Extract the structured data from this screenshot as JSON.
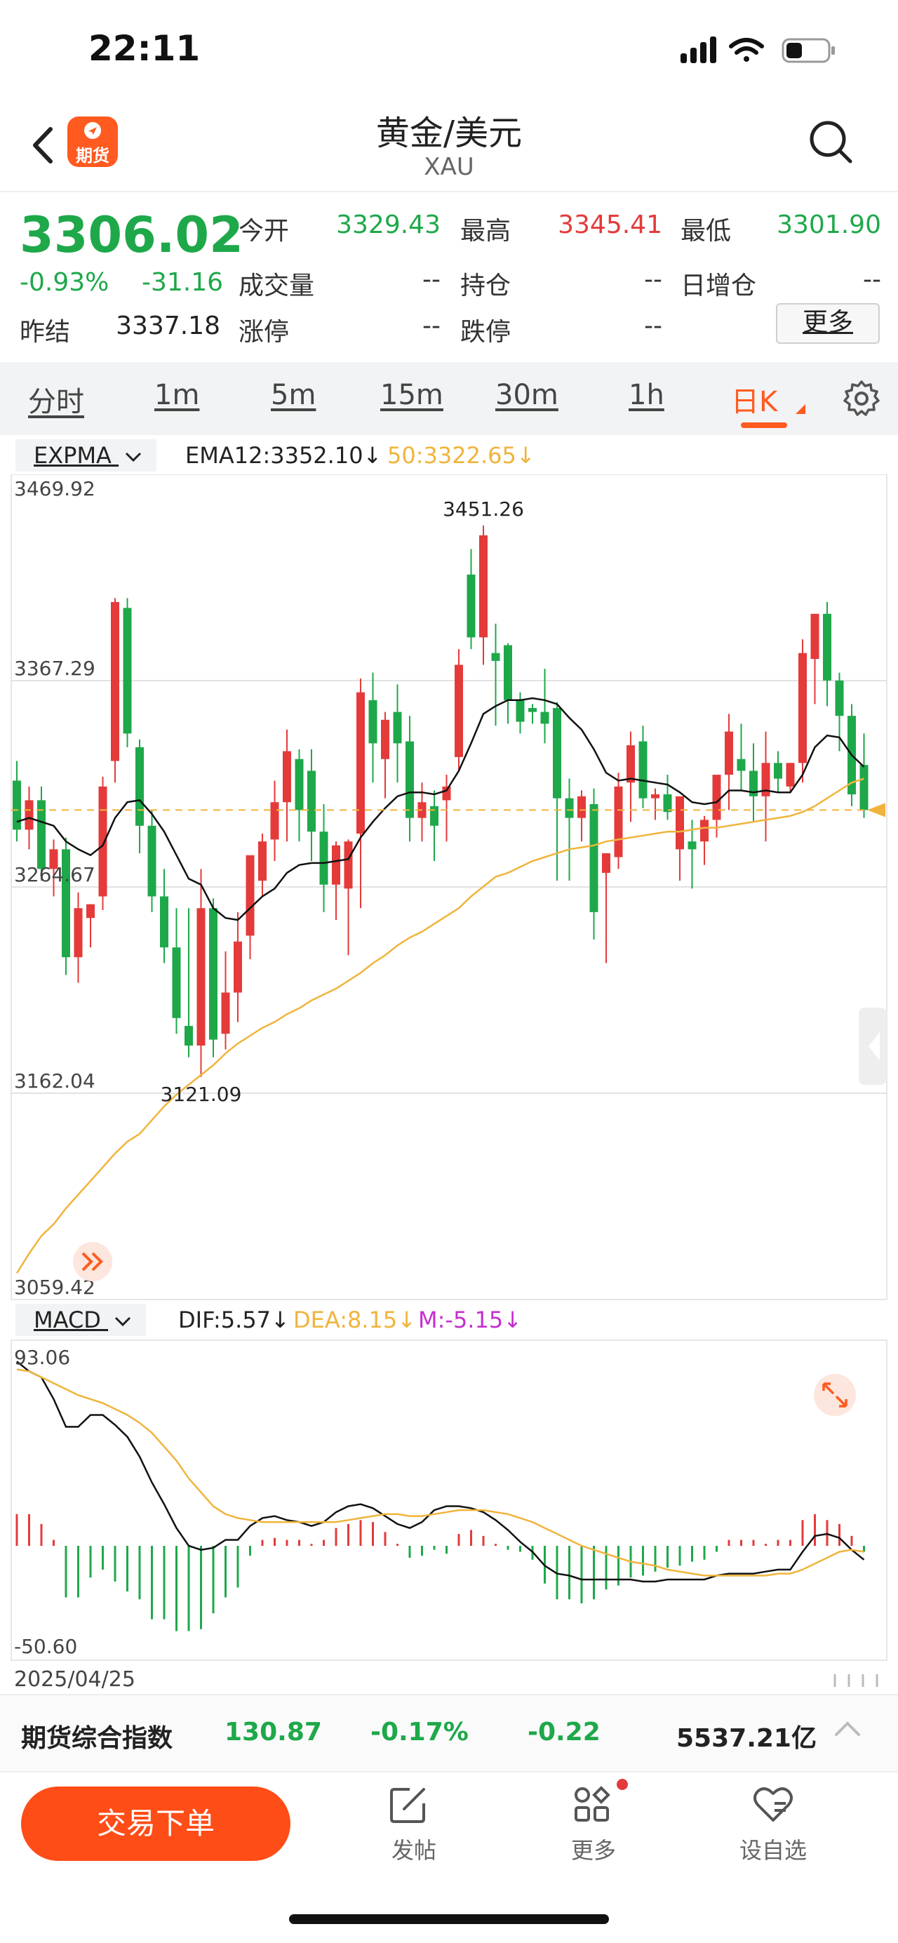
{
  "status_bar": {
    "time": "22:11"
  },
  "header": {
    "title": "黄金/美元",
    "subtitle": "XAU",
    "logo_text": "期货"
  },
  "quote": {
    "price": "3306.02",
    "change_pct": "-0.93%",
    "change_abs": "-31.16",
    "fields": [
      {
        "label": "今开",
        "value": "3329.43",
        "color": "#1ea84a"
      },
      {
        "label": "最高",
        "value": "3345.41",
        "color": "#e43a3a"
      },
      {
        "label": "最低",
        "value": "3301.90",
        "color": "#1ea84a"
      },
      {
        "label": "成交量",
        "value": "--",
        "color": "#333333"
      },
      {
        "label": "持仓",
        "value": "--",
        "color": "#333333"
      },
      {
        "label": "日增仓",
        "value": "--",
        "color": "#333333"
      },
      {
        "label": "昨结",
        "value": "3337.18",
        "color": "#222222"
      },
      {
        "label": "涨停",
        "value": "--",
        "color": "#333333"
      },
      {
        "label": "跌停",
        "value": "--",
        "color": "#333333"
      }
    ],
    "more_label": "更多"
  },
  "tabs": [
    "分时",
    "1m",
    "5m",
    "15m",
    "30m",
    "1h",
    "日K"
  ],
  "active_tab": "日K",
  "main_indicator": {
    "selector": "EXPMA",
    "ema12": "EMA12:3352.10↓",
    "ema50": "50:3322.65↓"
  },
  "macd_indicator": {
    "selector": "MACD",
    "dif": "DIF:5.57↓",
    "dea": "DEA:8.15↓",
    "m": "M:-5.15↓"
  },
  "colors": {
    "up": "#e43a3a",
    "down": "#1ea84a",
    "ema_slow": "#f0b43c",
    "accent": "#ff5a1f"
  },
  "chart_data": [
    {
      "type": "candlestick",
      "axis_labels": [
        "3469.92",
        "3367.29",
        "3264.67",
        "3162.04",
        "3059.42"
      ],
      "ylim": [
        3059.42,
        3469.92
      ],
      "grid": true,
      "annotations": {
        "high": "3451.26",
        "low": "3121.09"
      },
      "current_price": 3306.02,
      "candles": [
        [
          3321,
          3331,
          3290,
          3296
        ],
        [
          3296,
          3318,
          3286,
          3311
        ],
        [
          3311,
          3318,
          3270,
          3276
        ],
        [
          3276,
          3291,
          3262,
          3286
        ],
        [
          3286,
          3292,
          3222,
          3231
        ],
        [
          3231,
          3264,
          3218,
          3256
        ],
        [
          3251,
          3258,
          3236,
          3258
        ],
        [
          3262,
          3323,
          3255,
          3318
        ],
        [
          3331,
          3414,
          3320,
          3412
        ],
        [
          3409,
          3414,
          3338,
          3345
        ],
        [
          3338,
          3342,
          3284,
          3298
        ],
        [
          3298,
          3306,
          3254,
          3262
        ],
        [
          3262,
          3276,
          3228,
          3236
        ],
        [
          3236,
          3256,
          3192,
          3200
        ],
        [
          3196,
          3256,
          3180,
          3186
        ],
        [
          3186,
          3276,
          3170,
          3256
        ],
        [
          3256,
          3261,
          3180,
          3189
        ],
        [
          3192,
          3234,
          3184,
          3213
        ],
        [
          3213,
          3254,
          3198,
          3239
        ],
        [
          3242,
          3280,
          3230,
          3283
        ],
        [
          3270,
          3294,
          3262,
          3290
        ],
        [
          3291,
          3321,
          3280,
          3310
        ],
        [
          3310,
          3347,
          3290,
          3336
        ],
        [
          3332,
          3337,
          3290,
          3306
        ],
        [
          3326,
          3337,
          3280,
          3295
        ],
        [
          3295,
          3309,
          3254,
          3268
        ],
        [
          3268,
          3290,
          3250,
          3288
        ],
        [
          3266,
          3291,
          3232,
          3290
        ],
        [
          3294,
          3373,
          3256,
          3366
        ],
        [
          3362,
          3376,
          3320,
          3340
        ],
        [
          3332,
          3356,
          3312,
          3352
        ],
        [
          3356,
          3370,
          3320,
          3340
        ],
        [
          3341,
          3354,
          3290,
          3302
        ],
        [
          3302,
          3320,
          3290,
          3310
        ],
        [
          3308,
          3316,
          3280,
          3298
        ],
        [
          3311,
          3324,
          3290,
          3318
        ],
        [
          3333,
          3388,
          3326,
          3380
        ],
        [
          3426,
          3439,
          3388,
          3394
        ],
        [
          3394,
          3451,
          3380,
          3446
        ],
        [
          3386,
          3401,
          3349,
          3382
        ],
        [
          3390,
          3391,
          3350,
          3362
        ],
        [
          3362,
          3366,
          3345,
          3351
        ],
        [
          3358,
          3360,
          3350,
          3356
        ],
        [
          3356,
          3378,
          3340,
          3350
        ],
        [
          3358,
          3361,
          3270,
          3312
        ],
        [
          3312,
          3322,
          3270,
          3302
        ],
        [
          3302,
          3316,
          3290,
          3313
        ],
        [
          3309,
          3317,
          3240,
          3254
        ],
        [
          3274,
          3284,
          3228,
          3284
        ],
        [
          3282,
          3325,
          3276,
          3318
        ],
        [
          3320,
          3346,
          3300,
          3339
        ],
        [
          3341,
          3349,
          3307,
          3312
        ],
        [
          3312,
          3317,
          3301,
          3314
        ],
        [
          3314,
          3324,
          3301,
          3305
        ],
        [
          3286,
          3301,
          3270,
          3313
        ],
        [
          3290,
          3301,
          3266,
          3286
        ],
        [
          3290,
          3303,
          3278,
          3301
        ],
        [
          3301,
          3320,
          3292,
          3324
        ],
        [
          3324,
          3355,
          3306,
          3346
        ],
        [
          3332,
          3350,
          3316,
          3326
        ],
        [
          3326,
          3340,
          3300,
          3313
        ],
        [
          3313,
          3346,
          3290,
          3330
        ],
        [
          3330,
          3336,
          3315,
          3322
        ],
        [
          3318,
          3330,
          3315,
          3330
        ],
        [
          3330,
          3393,
          3320,
          3386
        ],
        [
          3383,
          3404,
          3360,
          3406
        ],
        [
          3406,
          3412,
          3359,
          3372
        ],
        [
          3372,
          3376,
          3336,
          3354
        ],
        [
          3354,
          3360,
          3308,
          3314
        ],
        [
          3329,
          3345,
          3302,
          3306
        ]
      ],
      "ema12": [
        3300,
        3302,
        3300,
        3298,
        3290,
        3286,
        3283,
        3288,
        3302,
        3310,
        3311,
        3304,
        3295,
        3283,
        3271,
        3268,
        3256,
        3251,
        3250,
        3256,
        3262,
        3266,
        3274,
        3278,
        3279,
        3279,
        3280,
        3281,
        3292,
        3300,
        3307,
        3313,
        3315,
        3315,
        3314,
        3316,
        3326,
        3340,
        3355,
        3359,
        3362,
        3362,
        3363,
        3362,
        3360,
        3353,
        3347,
        3337,
        3325,
        3321,
        3322,
        3321,
        3320,
        3319,
        3315,
        3310,
        3309,
        3310,
        3316,
        3316,
        3315,
        3316,
        3315,
        3315,
        3324,
        3338,
        3344,
        3343,
        3334,
        3328
      ],
      "ema50": [
        3070,
        3080,
        3089,
        3095,
        3103,
        3110,
        3117,
        3124,
        3131,
        3137,
        3141,
        3148,
        3155,
        3161,
        3166,
        3171,
        3176,
        3182,
        3187,
        3191,
        3195,
        3198,
        3202,
        3205,
        3209,
        3212,
        3215,
        3219,
        3223,
        3228,
        3232,
        3237,
        3241,
        3244,
        3248,
        3252,
        3256,
        3262,
        3267,
        3272,
        3274,
        3277,
        3280,
        3282,
        3284,
        3286,
        3287,
        3288,
        3290,
        3291,
        3292,
        3293,
        3294,
        3295,
        3295,
        3296,
        3297,
        3297,
        3298,
        3299,
        3300,
        3301,
        3302,
        3303,
        3305,
        3308,
        3312,
        3316,
        3320,
        3322
      ]
    },
    {
      "type": "macd",
      "axis_labels": [
        "93.06",
        "-50.60"
      ],
      "ylim": [
        -50.6,
        93.06
      ],
      "dif": [
        93,
        88,
        85,
        74,
        60,
        60,
        66,
        66,
        61,
        55,
        45,
        32,
        21,
        9,
        0,
        -2,
        -1,
        3,
        3,
        10,
        14,
        15,
        13,
        12,
        10,
        12,
        17,
        20,
        21,
        19,
        15,
        11,
        9,
        12,
        18,
        20,
        20,
        19,
        17,
        13,
        8,
        2,
        -3,
        -10,
        -14,
        -15,
        -17,
        -17,
        -17,
        -17,
        -17,
        -18,
        -18,
        -17,
        -17,
        -17,
        -17,
        -15,
        -14,
        -14,
        -14,
        -13,
        -12,
        -12,
        -3,
        5,
        6,
        4,
        -2,
        -7
      ],
      "dea": [
        89,
        88,
        85,
        82,
        79,
        76,
        74,
        72,
        69,
        66,
        62,
        57,
        50,
        43,
        34,
        27,
        20,
        16,
        14,
        13,
        12,
        12,
        12,
        12,
        12,
        12,
        12,
        13,
        14,
        15,
        16,
        16,
        15,
        15,
        16,
        17,
        18,
        18,
        18,
        17,
        16,
        14,
        12,
        9,
        6,
        3,
        0,
        -2,
        -4,
        -6,
        -8,
        -9,
        -10,
        -12,
        -13,
        -14,
        -15,
        -15,
        -15,
        -15,
        -15,
        -15,
        -14,
        -14,
        -12,
        -9,
        -6,
        -3,
        -2,
        -3
      ],
      "m": [
        16,
        16,
        11,
        3,
        -26,
        -26,
        -16,
        -12,
        -18,
        -23,
        -27,
        -37,
        -37,
        -43,
        -43,
        -42,
        -34,
        -26,
        -21,
        -5,
        3,
        4,
        3,
        3,
        1,
        3,
        9,
        11,
        13,
        12,
        7,
        1,
        -6,
        -5,
        -2,
        -4,
        6,
        8,
        5,
        1,
        -2,
        -3,
        -7,
        -19,
        -27,
        -27,
        -29,
        -27,
        -22,
        -20,
        -16,
        -15,
        -13,
        -11,
        -10,
        -8,
        -7,
        -3,
        3,
        3,
        3,
        1,
        3,
        3,
        13,
        16,
        13,
        11,
        5,
        -3
      ]
    }
  ],
  "date_label": "2025/04/25",
  "index_bar": {
    "name": "期货综合指数",
    "value": "130.87",
    "pct": "-0.17%",
    "abs": "-0.22",
    "volume": "5537.21亿"
  },
  "toolbar": {
    "trade_label": "交易下单",
    "items": [
      {
        "label": "发帖",
        "icon": "compose-icon"
      },
      {
        "label": "更多",
        "icon": "grid-icon"
      },
      {
        "label": "设自选",
        "icon": "heart-icon"
      }
    ]
  }
}
